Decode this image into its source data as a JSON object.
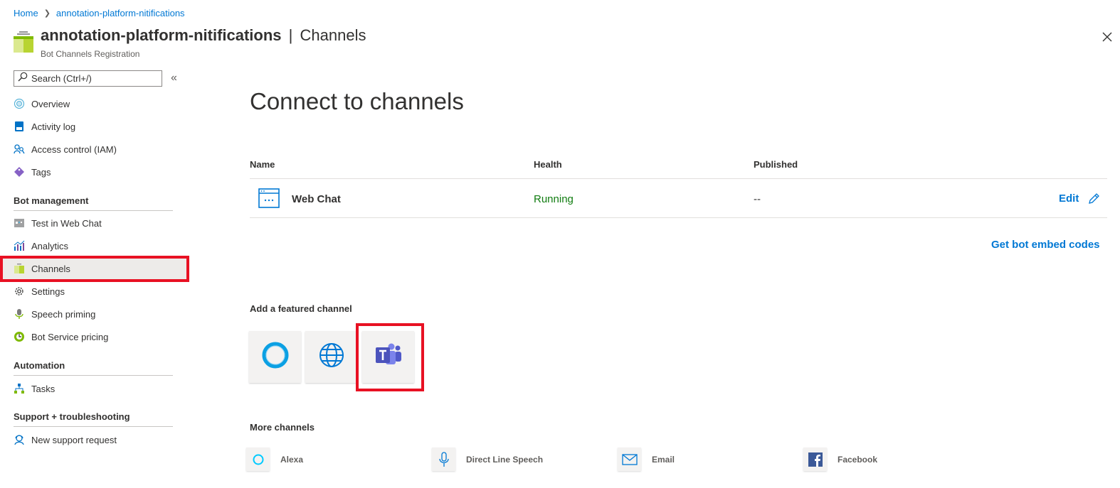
{
  "breadcrumb": {
    "home": "Home",
    "current": "annotation-platform-nitifications"
  },
  "header": {
    "resource_name": "annotation-platform-nitifications",
    "separator": "|",
    "blade_name": "Channels",
    "subtitle": "Bot Channels Registration"
  },
  "sidebar": {
    "search_placeholder": "Search (Ctrl+/)",
    "collapse_glyph": "«",
    "top_items": [
      {
        "label": "Overview",
        "icon": "overview-icon"
      },
      {
        "label": "Activity log",
        "icon": "activity-log-icon"
      },
      {
        "label": "Access control (IAM)",
        "icon": "access-control-icon"
      },
      {
        "label": "Tags",
        "icon": "tag-icon"
      }
    ],
    "sections": [
      {
        "title": "Bot management",
        "items": [
          {
            "label": "Test in Web Chat",
            "icon": "test-web-chat-icon"
          },
          {
            "label": "Analytics",
            "icon": "analytics-icon"
          },
          {
            "label": "Channels",
            "icon": "channels-icon",
            "active": true
          },
          {
            "label": "Settings",
            "icon": "gear-icon"
          },
          {
            "label": "Speech priming",
            "icon": "microphone-icon"
          },
          {
            "label": "Bot Service pricing",
            "icon": "pricing-icon"
          }
        ]
      },
      {
        "title": "Automation",
        "items": [
          {
            "label": "Tasks",
            "icon": "tasks-icon"
          }
        ]
      },
      {
        "title": "Support + troubleshooting",
        "items": [
          {
            "label": "New support request",
            "icon": "support-icon"
          }
        ]
      }
    ]
  },
  "main": {
    "title": "Connect to channels",
    "table": {
      "columns": [
        "Name",
        "Health",
        "Published"
      ],
      "rows": [
        {
          "name": "Web Chat",
          "health": "Running",
          "published": "--",
          "action": "Edit"
        }
      ]
    },
    "embed_link": "Get bot embed codes",
    "featured_heading": "Add a featured channel",
    "featured_channels": [
      {
        "icon": "cortana-icon"
      },
      {
        "icon": "globe-icon"
      },
      {
        "icon": "teams-icon",
        "highlighted": true
      }
    ],
    "more_heading": "More channels",
    "more_channels": [
      {
        "label": "Alexa",
        "icon": "alexa-icon"
      },
      {
        "label": "Direct Line Speech",
        "icon": "microphone-icon"
      },
      {
        "label": "Email",
        "icon": "email-icon"
      },
      {
        "label": "Facebook",
        "icon": "facebook-icon"
      }
    ]
  },
  "colors": {
    "link": "#0078d4",
    "running": "#107c10",
    "highlight": "#e81123",
    "active_bg": "#edebe9",
    "teams": "#5059c9"
  }
}
